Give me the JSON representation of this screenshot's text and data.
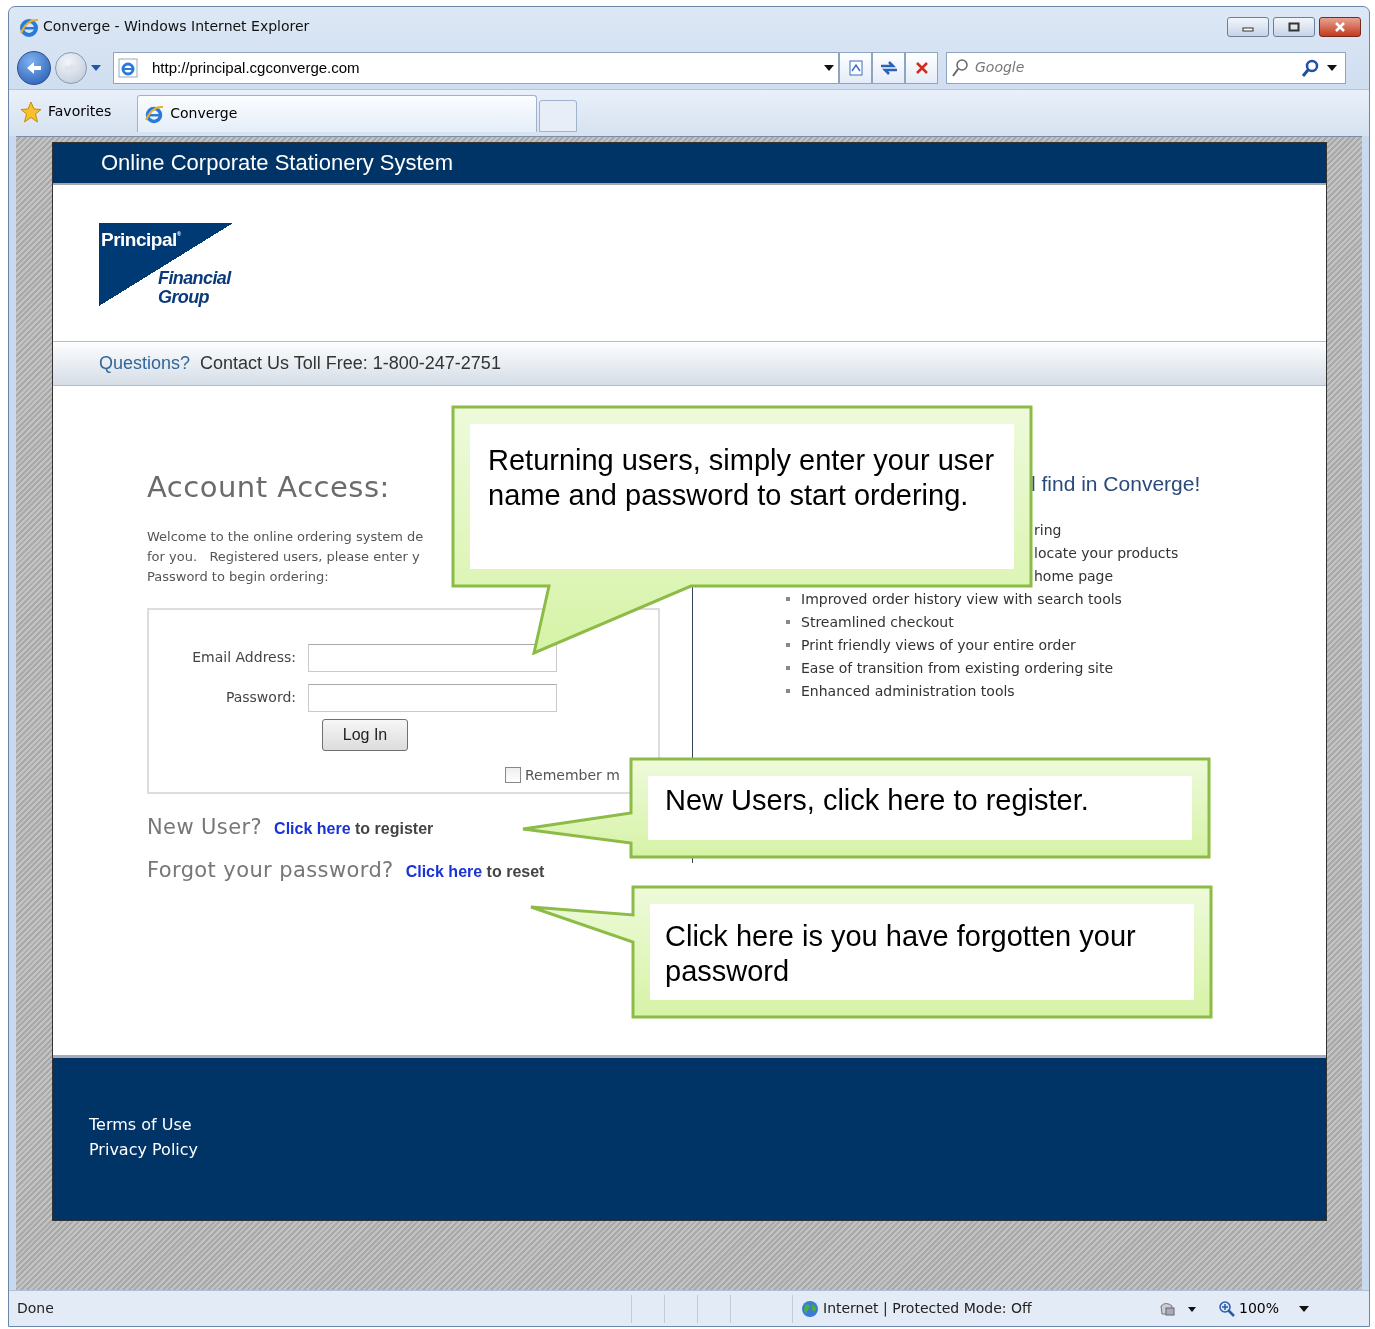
{
  "window": {
    "title": "Converge - Windows Internet Explorer"
  },
  "address_bar": {
    "url": "http://principal.cgconverge.com"
  },
  "search": {
    "placeholder": "Google"
  },
  "favorites": {
    "label": "Favorites"
  },
  "tabs": [
    {
      "label": "Converge",
      "selected": true
    }
  ],
  "page": {
    "header_title": "Online Corporate Stationery System",
    "logo": {
      "name": "Principal$^{®}$",
      "line1": "Financial",
      "line2": "Group"
    },
    "contact": {
      "questions": "Questions?",
      "phone": "Contact Us Toll Free: 1-800-247-2751"
    },
    "account": {
      "heading": "Account Access:",
      "welcome_lines": [
        "Welcome to the online ordering system de",
        "for you.   Registered users, please enter y",
        "Password to begin ordering:"
      ],
      "email_label": "Email Address:",
      "password_label": "Password:",
      "login_button": "Log In",
      "remember": {
        "label": "Remember m",
        "checked": false
      },
      "new_user": {
        "question": "New User?",
        "link": "Click here",
        "rest": " to register"
      },
      "forgot": {
        "question": "Forgot your password?",
        "link": "Click here",
        "rest": " to reset"
      }
    },
    "features": {
      "heading": "l find in Converge!",
      "items": [
        {
          "text": "ring",
          "bullet": false
        },
        {
          "text": "locate your products",
          "bullet": false
        },
        {
          "text": "home page",
          "bullet": false
        },
        {
          "text": "Improved order history view with search tools",
          "bullet": true
        },
        {
          "text": "Streamlined checkout",
          "bullet": true
        },
        {
          "text": "Print friendly views of your entire order",
          "bullet": true
        },
        {
          "text": "Ease of transition from existing ordering site",
          "bullet": true
        },
        {
          "text": "Enhanced administration tools",
          "bullet": true
        }
      ]
    },
    "footer_links": [
      "Terms of Use",
      "Privacy Policy"
    ]
  },
  "callouts": [
    {
      "text": "Returning users, simply enter your user name and password to start ordering."
    },
    {
      "text": "New Users, click here to register."
    },
    {
      "text": "Click here is you have forgotten your password"
    }
  ],
  "status_bar": {
    "text": "Done",
    "zone": "Internet | Protected Mode: Off",
    "zoom": "100%"
  }
}
